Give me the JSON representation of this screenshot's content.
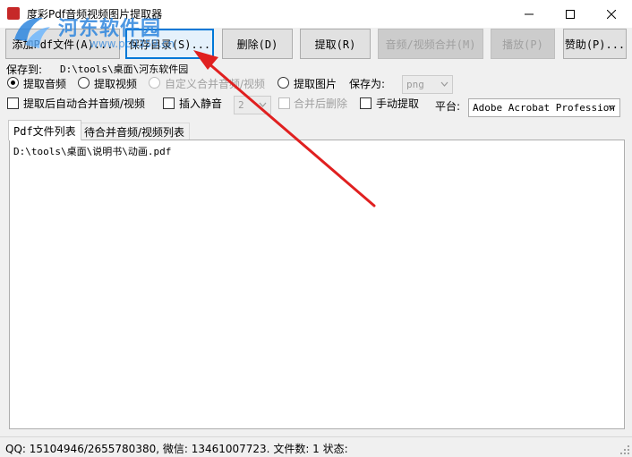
{
  "window": {
    "title": "度彩Pdf音频视频图片提取器",
    "controls": [
      "minimize",
      "maximize",
      "close"
    ]
  },
  "toolbar": {
    "add_pdf": "添加Pdf文件(A)...",
    "save_dir": "保存目录(S)...",
    "delete": "删除(D)",
    "extract": "提取(R)",
    "merge": "音频/视频合并(M)",
    "play": "播放(P)",
    "donate": "赞助(P)..."
  },
  "save": {
    "label": "保存到:",
    "path": "D:\\tools\\桌面\\河东软件园"
  },
  "options": {
    "extract_audio": "提取音频",
    "extract_video": "提取视频",
    "custom_merge": "自定义合并音频/视频",
    "extract_image": "提取图片",
    "save_as_label": "保存为:",
    "save_as_value": "png",
    "auto_merge": "提取后自动合并音频/视频",
    "insert_silence": "插入静音",
    "silence_value": "2",
    "delete_after_merge": "合并后删除",
    "manual_extract": "手动提取",
    "platform_label": "平台:",
    "platform_value": "Adobe Acrobat Profession"
  },
  "tabs": [
    {
      "label": "Pdf文件列表",
      "active": true
    },
    {
      "label": "待合并音频/视频列表",
      "active": false
    }
  ],
  "file_list": [
    "D:\\tools\\桌面\\说明书\\动画.pdf"
  ],
  "status": {
    "text": "QQ: 15104946/2655780380, 微信: 13461007723.  文件数: 1  状态:"
  },
  "watermark": {
    "main": "河东软件园",
    "sub": "www.pc0359.cn"
  },
  "colors": {
    "focus": "#0078d7",
    "arrow": "#e02020",
    "watermark": "#2e86de"
  }
}
